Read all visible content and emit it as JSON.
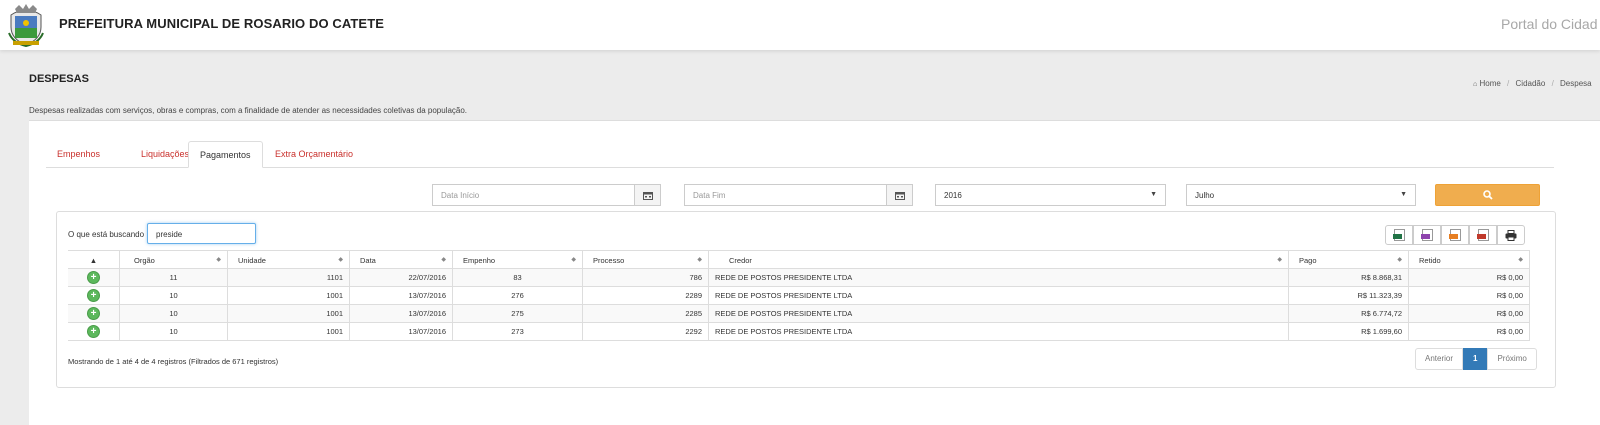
{
  "header": {
    "site_title": "PREFEITURA MUNICIPAL DE ROSARIO DO CATETE",
    "portal_title": "Portal do Cidad"
  },
  "page": {
    "title": "DESPESAS",
    "description": "Despesas realizadas com serviços, obras e compras, com a finalidade de atender as necessidades coletivas da população.",
    "breadcrumb": [
      "Home",
      "Cidadão",
      "Despesa"
    ]
  },
  "tabs": [
    "Empenhos",
    "Liquidações",
    "Pagamentos",
    "Extra Orçamentário"
  ],
  "active_tab": "Pagamentos",
  "filters": {
    "start_date_placeholder": "Data Início",
    "end_date_placeholder": "Data Fim",
    "year": "2016",
    "month": "Julho"
  },
  "search": {
    "label": "O que está buscando",
    "value": "preside"
  },
  "export_icons": [
    "xls-icon",
    "xml-icon",
    "csv-icon",
    "pdf-icon",
    "print-icon"
  ],
  "table": {
    "columns": [
      "",
      "Orgão",
      "Unidade",
      "Data",
      "Empenho",
      "Processo",
      "Credor",
      "Pago",
      "Retido"
    ],
    "rows": [
      [
        "11",
        "1101",
        "22/07/2016",
        "83",
        "786",
        "REDE DE POSTOS PRESIDENTE LTDA",
        "R$ 8.868,31",
        "R$ 0,00"
      ],
      [
        "10",
        "1001",
        "13/07/2016",
        "276",
        "2289",
        "REDE DE POSTOS PRESIDENTE LTDA",
        "R$ 11.323,39",
        "R$ 0,00"
      ],
      [
        "10",
        "1001",
        "13/07/2016",
        "275",
        "2285",
        "REDE DE POSTOS PRESIDENTE LTDA",
        "R$ 6.774,72",
        "R$ 0,00"
      ],
      [
        "10",
        "1001",
        "13/07/2016",
        "273",
        "2292",
        "REDE DE POSTOS PRESIDENTE LTDA",
        "R$ 1.699,60",
        "R$ 0,00"
      ]
    ]
  },
  "info": "Mostrando de 1 até 4 de 4 registros (Filtrados de 671 registros)",
  "pagination": {
    "prev": "Anterior",
    "current": "1",
    "next": "Próximo"
  },
  "colors": {
    "tab_link": "#c9302c",
    "search_button": "#f0ad4e",
    "pagination_active": "#337ab7",
    "row_expand": "#5cb85c"
  }
}
